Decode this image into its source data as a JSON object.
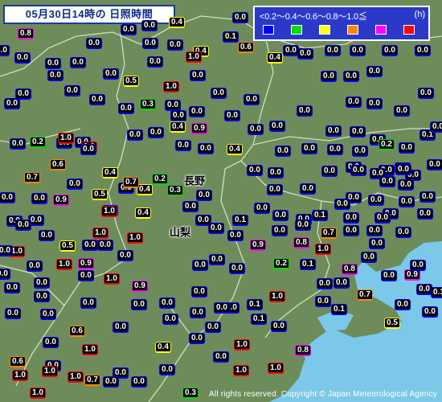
{
  "title": "05月30日14時の 日照時間",
  "legend": {
    "scale_text": "<0.2～0.4～0.6～0.8～1.0≦",
    "unit": "(h)",
    "swatches": [
      {
        "label": "<0.2",
        "color": "#0000ff"
      },
      {
        "label": "0.2-0.4",
        "color": "#00dd00"
      },
      {
        "label": "0.4-0.6",
        "color": "#ffff00"
      },
      {
        "label": "0.6-0.8",
        "color": "#ff8800"
      },
      {
        "label": "0.8-1.0",
        "color": "#ff00ff"
      },
      {
        "label": "1.0≦",
        "color": "#ff0000"
      }
    ]
  },
  "places": [
    {
      "name": "長野"
    },
    {
      "name": "山梨"
    }
  ],
  "colors": {
    "land": "#6d8c5a",
    "sea": "#7cc8e8",
    "border": "#cfe0c0",
    "c0": "#0000ff",
    "c1": "#00dd00",
    "c2": "#ffff00",
    "c3": "#ff8800",
    "c4": "#ff00ff",
    "c5": "#ff0000"
  },
  "copyright": "All rights reserved. Copyright © Japan Meteorological Agency",
  "values": [
    "0.8",
    "0.4",
    "0.0",
    "0.0",
    "0.0",
    "0.0",
    "0.0",
    "0.4",
    "0.0",
    "0.1",
    "0.0",
    "0.0",
    "0.0",
    "0.0",
    "1.0",
    "0.6",
    "0.4",
    "0.0",
    "0.0",
    "0.0",
    "0.0",
    "0.0",
    "0.0",
    "0.0",
    "0.0",
    "0.0",
    "0.5",
    "1.0",
    "0.0",
    "0.0",
    "0.0",
    "0.0",
    "0.0",
    "0.0",
    "0.0",
    "0.0",
    "0.0",
    "0.0",
    "0.0",
    "0.3",
    "0.0",
    "0.0",
    "0.0",
    "0.0",
    "0.0",
    "0.0",
    "0.0",
    "0.0",
    "0.0",
    "0.4",
    "0.9",
    "0.0",
    "0.0",
    "0.0",
    "0.0",
    "0.0",
    "0.0",
    "0.0",
    "0.0",
    "0.0",
    "1.0",
    "0.0",
    "0.4",
    "0.2",
    "1.0",
    "0.0",
    "0.0",
    "0.0",
    "0.0",
    "0.0",
    "0.1",
    "0.0",
    "0.0",
    "0.2",
    "0.0",
    "0.6",
    "0.0",
    "0.0",
    "0.0",
    "0.0",
    "0.0",
    "0.0",
    "0.0",
    "0.0",
    "0.4",
    "0.2",
    "0.7",
    "0.0",
    "0.0",
    "0.0",
    "0.0",
    "0.0",
    "0.0",
    "0.0",
    "0.4",
    "0.3",
    "0.5",
    "0.7",
    "0.0",
    "0.0",
    "0.0",
    "0.0",
    "0.0",
    "0.0",
    "0.0",
    "0.0",
    "0.0",
    "0.0",
    "0.0",
    "0.0",
    "0.0",
    "0.0",
    "0.0",
    "0.0",
    "0.0",
    "0.0",
    "0.9",
    "1.0",
    "0.4",
    "0.1",
    "0.1",
    "0.0",
    "0.0",
    "0.0",
    "0.0",
    "0.0",
    "0.0",
    "0.0",
    "0.7",
    "0.0",
    "0.0",
    "0.0",
    "0.0",
    "0.0",
    "0.0",
    "1.0",
    "0.5",
    "1.0",
    "0.0",
    "0.0",
    "1.0",
    "0.9",
    "0.8",
    "1.0",
    "0.0",
    "0.0",
    "0.0",
    "0.0",
    "0.0",
    "0.0",
    "1.0",
    "0.9",
    "0.0",
    "0.2",
    "0.1",
    "0.0",
    "0.0",
    "0.0",
    "0.0",
    "1.0",
    "0.9",
    "0.0",
    "0.0",
    "0.0",
    "0.0",
    "0.8",
    "0.9",
    "0.0",
    "0.0",
    "0.0",
    "0.0",
    "0.0",
    "0.0",
    "0.1",
    "1.0",
    "0.0",
    "0.0",
    "0.0",
    "0.0",
    "0.7",
    "0.1",
    "0.0",
    "0.0",
    "0.0",
    "0.0",
    "0.0",
    "0.0",
    "0.0",
    "0.0",
    "0.1",
    "0.0",
    "0.1",
    "0.5",
    "0.0",
    "0.6",
    "0.0",
    "1.0",
    "0.4",
    "0.0",
    "0.0",
    "1.0",
    "0.8",
    "0.6",
    "0.0",
    "0.0",
    "0.0",
    "1.0",
    "1.0",
    "1.0",
    "0.7",
    "0.3",
    "1.0",
    "1.0",
    "1.0",
    "0.0",
    "0.0"
  ]
}
